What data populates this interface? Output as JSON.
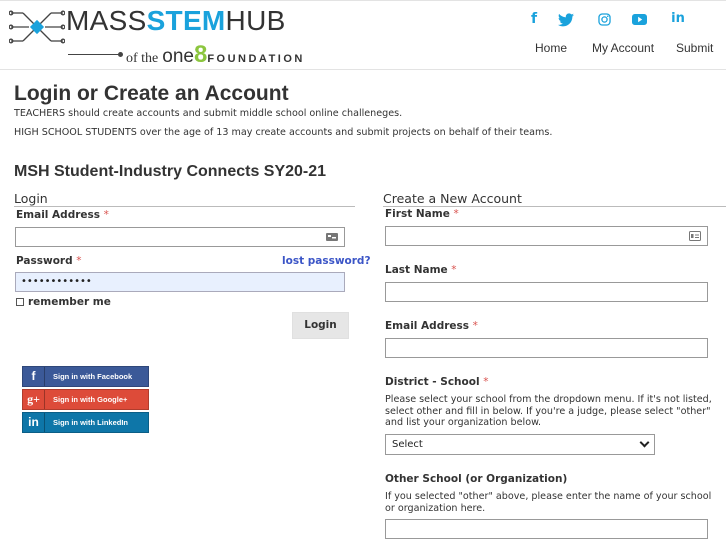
{
  "header": {
    "logo": {
      "mass": "MASS",
      "stem": "STEM",
      "hub": "HUB",
      "of": "of the",
      "one": "one",
      "eight": "8",
      "foundation": "FOUNDATION"
    },
    "social": [
      {
        "name": "facebook-icon",
        "glyph": "f"
      },
      {
        "name": "twitter-icon",
        "glyph": "🐦"
      },
      {
        "name": "instagram-icon",
        "glyph": "◎"
      },
      {
        "name": "youtube-icon",
        "glyph": "▶"
      },
      {
        "name": "linkedin-icon",
        "glyph": "in"
      }
    ],
    "nav": [
      "Home",
      "My Account",
      "Submit"
    ]
  },
  "page": {
    "title": "Login or Create an Account",
    "intro1": "TEACHERS should create accounts and submit middle school online challeneges.",
    "intro2": "HIGH SCHOOL STUDENTS over the age of 13 may create accounts and submit projects on behalf of their teams.",
    "section": "MSH Student-Industry Connects SY20-21"
  },
  "login": {
    "title": "Login",
    "email_label": "Email Address",
    "email_value": "",
    "password_label": "Password",
    "password_value": "••••••••••••",
    "lost_password": "lost password?",
    "remember": "remember me",
    "button": "Login",
    "required_mark": "*"
  },
  "sso": {
    "facebook": "Sign in with Facebook",
    "google": "Sign in with Google+",
    "linkedin": "Sign in with LinkedIn",
    "facebook_icon": "f",
    "google_icon": "g+",
    "linkedin_icon": "in"
  },
  "register": {
    "title": "Create a New Account",
    "first_name_label": "First Name",
    "last_name_label": "Last Name",
    "email_label": "Email Address",
    "district_label": "District - School",
    "district_help": "Please select your school from the dropdown menu. If it's not listed, select other and fill in below. If you're a judge, please select \"other\" and list your organization below.",
    "district_selected": "Select",
    "other_label": "Other School (or Organization)",
    "other_help": "If you selected \"other\" above, please enter the name of your school or organization here."
  },
  "colors": {
    "accent": "#1aa2dc",
    "brand_green": "#8cc63f",
    "link": "#3b55c7",
    "required": "#d9534f",
    "autofill": "#e8f0fe",
    "facebook": "#3b5998",
    "google": "#dd4b39",
    "linkedin": "#0e76a8"
  }
}
